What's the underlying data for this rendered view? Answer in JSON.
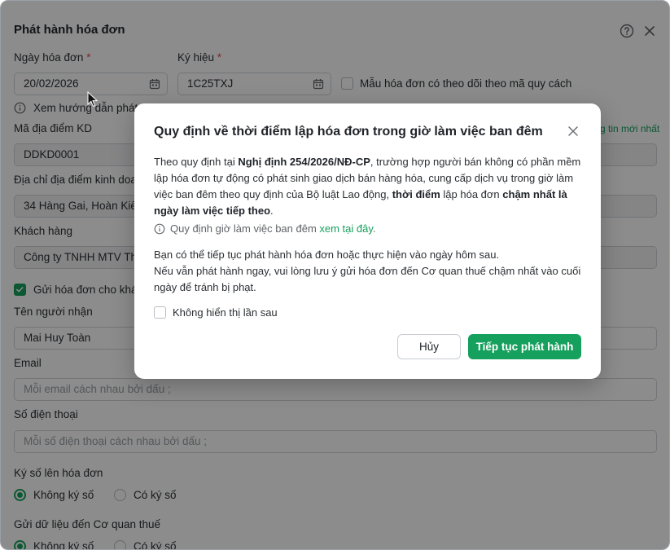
{
  "dialog": {
    "title": "Phát hành hóa đơn",
    "invoice_date_label": "Ngày hóa đơn",
    "invoice_date_value": "20/02/2026",
    "symbol_label": "Ký hiệu",
    "symbol_value": "1C25TXJ",
    "template_tracking_label": "Mẫu hóa đơn có theo dõi theo mã quy cách",
    "guide_text": "Xem hướng dẫn phát",
    "latest_info_link": "g tin mới nhất",
    "location_code_label": "Mã địa điểm KD",
    "location_code_value": "DDKD0001",
    "address_label": "Địa chỉ địa điểm kinh doa",
    "address_value": "34 Hàng Gai, Hoàn Kiế",
    "customer_label": "Khách hàng",
    "customer_value": "Công ty TNHH MTV Th",
    "send_invoice_label": "Gửi hóa đơn cho khá",
    "recipient_label": "Tên người nhận",
    "recipient_value": "Mai Huy Toàn",
    "email_label": "Email",
    "email_placeholder": "Mỗi email cách nhau bởi dấu ;",
    "phone_label": "Số điện thoại",
    "phone_placeholder": "Mỗi số điện thoại cách nhau bởi dấu ;",
    "sign_label": "Ký số lên hóa đơn",
    "sign_options": [
      "Không ký số",
      "Có ký số"
    ],
    "tax_label": "Gửi dữ liệu đến Cơ quan thuế",
    "tax_options": [
      "Không ký số",
      "Có ký số"
    ]
  },
  "modal": {
    "title": "Quy định về thời điểm lập hóa đơn trong giờ làm việc ban đêm",
    "p1_prefix": "Theo quy định tại ",
    "p1_decree": "Nghị định 254/2026/NĐ-CP",
    "p1_mid": ", trường hợp người bán không có phần mềm lập hóa đơn tự động có phát sinh giao dịch bán hàng hóa, cung cấp dịch vụ trong giờ làm việc ban đêm theo quy định của Bộ luật Lao động, ",
    "p1_bold1": "thời điểm",
    "p1_mid2": " lập hóa đơn ",
    "p1_bold2": "chậm nhất là ngày làm việc tiếp theo",
    "p1_end": ".",
    "info_text": "Quy định giờ làm việc ban đêm ",
    "info_link": "xem tại đây",
    "info_end": ".",
    "p2_line1": "Bạn có thể tiếp tục phát hành hóa đơn hoặc thực hiện vào ngày hôm sau.",
    "p2_line2": "Nếu vẫn phát hành ngay, vui lòng lưu ý gửi hóa đơn đến Cơ quan thuế chậm nhất vào cuối ngày để tránh bị phạt.",
    "dont_show_label": "Không hiển thị lần sau",
    "cancel_label": "Hủy",
    "continue_label": "Tiếp tục phát hành"
  },
  "colors": {
    "accent": "#16a05d",
    "required": "#e5484d",
    "overlay": "rgba(0,0,0,0.45)"
  },
  "icons": [
    "help-icon",
    "close-icon",
    "calendar-icon",
    "info-icon",
    "cursor-icon"
  ]
}
